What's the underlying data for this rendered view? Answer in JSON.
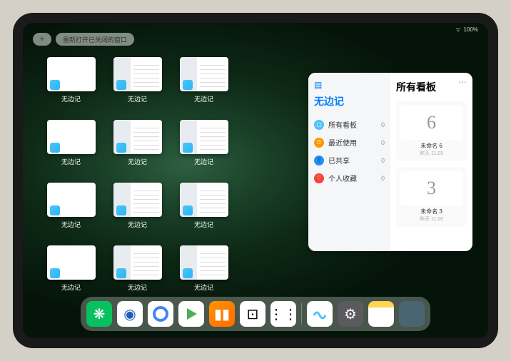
{
  "status": {
    "wifi": "ᯤ",
    "battery": "100%"
  },
  "topbar": {
    "plus_label": "+",
    "reopen_label": "重新打开已关闭的窗口"
  },
  "thumbs": [
    {
      "label": "无边记",
      "style": "plain"
    },
    {
      "label": "无边记",
      "style": "detailed"
    },
    {
      "label": "无边记",
      "style": "detailed"
    },
    {
      "label": "无边记",
      "style": "plain"
    },
    {
      "label": "无边记",
      "style": "detailed"
    },
    {
      "label": "无边记",
      "style": "detailed"
    },
    {
      "label": "无边记",
      "style": "plain"
    },
    {
      "label": "无边记",
      "style": "detailed"
    },
    {
      "label": "无边记",
      "style": "detailed"
    },
    {
      "label": "无边记",
      "style": "plain"
    },
    {
      "label": "无边记",
      "style": "detailed"
    },
    {
      "label": "无边记",
      "style": "detailed"
    }
  ],
  "panel": {
    "left_title": "无边记",
    "right_title": "所有看板",
    "items": [
      {
        "label": "所有看板",
        "count": "0",
        "color": "cyan",
        "glyph": "▢"
      },
      {
        "label": "最近使用",
        "count": "0",
        "color": "orange",
        "glyph": "⏱"
      },
      {
        "label": "已共享",
        "count": "0",
        "color": "blue",
        "glyph": "👤"
      },
      {
        "label": "个人收藏",
        "count": "0",
        "color": "red",
        "glyph": "♡"
      }
    ],
    "boards": [
      {
        "doodle": "6",
        "name": "未命名 6",
        "date": "昨天 11:25"
      },
      {
        "doodle": "3",
        "name": "未命名 3",
        "date": "昨天 11:20"
      }
    ]
  },
  "dock": {
    "apps": [
      {
        "name": "wechat",
        "glyph": "❋"
      },
      {
        "name": "hd-app",
        "glyph": "◉"
      },
      {
        "name": "browser",
        "glyph": "◯"
      },
      {
        "name": "play",
        "glyph": "▶"
      },
      {
        "name": "books",
        "glyph": "▮▮"
      },
      {
        "name": "dice",
        "glyph": "⊡"
      },
      {
        "name": "nodes",
        "glyph": "⋮⋮"
      }
    ],
    "recent": [
      {
        "name": "freeform",
        "glyph": "〰"
      },
      {
        "name": "settings",
        "glyph": "⚙"
      },
      {
        "name": "notes",
        "glyph": ""
      },
      {
        "name": "app-library",
        "glyph": ""
      }
    ]
  }
}
